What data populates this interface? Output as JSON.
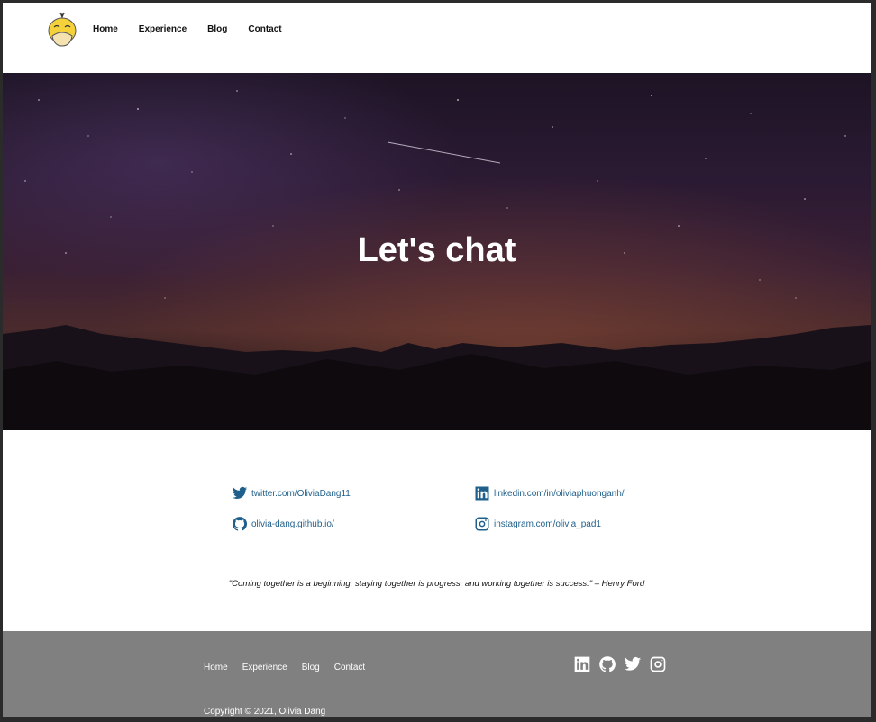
{
  "header": {
    "logo_icon": "psyduck-logo-icon",
    "nav": [
      "Home",
      "Experience",
      "Blog",
      "Contact"
    ]
  },
  "hero": {
    "title": "Let's chat"
  },
  "contacts": [
    {
      "icon": "twitter-icon",
      "text": "twitter.com/OliviaDang11"
    },
    {
      "icon": "linkedin-icon",
      "text": "linkedin.com/in/oliviaphuonganh/"
    },
    {
      "icon": "github-icon",
      "text": "olivia-dang.github.io/"
    },
    {
      "icon": "instagram-icon",
      "text": "instagram.com/olivia_pad1"
    }
  ],
  "quote": "\"Coming together is a beginning, staying together is progress, and working together is success.\" – Henry Ford",
  "footer": {
    "nav": [
      "Home",
      "Experience",
      "Blog",
      "Contact"
    ],
    "social": [
      "linkedin-icon",
      "github-icon",
      "twitter-icon",
      "instagram-icon"
    ],
    "copyright": "Copyright © 2021, Olivia Dang"
  },
  "colors": {
    "link": "#1f5f8b",
    "footer_bg": "#808080"
  }
}
